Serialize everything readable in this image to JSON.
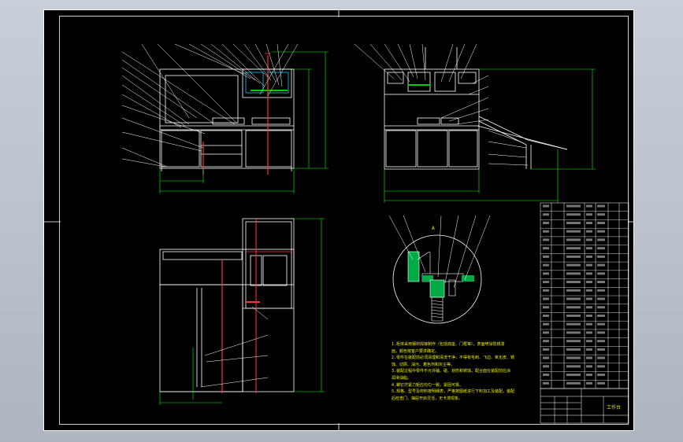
{
  "drawing": {
    "sheet_background": "#000000",
    "outer_frame_color": "#ffffff",
    "geometry_color": "#ffffff",
    "leader_color": "#ffffff",
    "dimension_color": "#00ff00",
    "section_line_color": "#ff3333",
    "hatch_color": "#00cc00",
    "text_color": "#f2f200",
    "cyan_color": "#00ccff"
  },
  "views": {
    "section_label": "A",
    "dim_labels": [
      "1800",
      "2200",
      "1790",
      "1600",
      "2460",
      "1200",
      "160",
      "1500",
      "600"
    ]
  },
  "notes": {
    "lines": [
      "1.柜体采用钢材焊接制作（包括底座、门框等），表面喷涂防锈漆",
      "面，颜色按客户要求确定。",
      "2.零件在装配前必须清理和清洗干净，不得有毛刺、飞边、氧化皮、锈",
      "蚀、切屑、油污、着色剂和灰尘等。",
      "3.装配过程中零件不允许磕、碰、划伤和锈蚀，配合面在装配前应涂",
      "润滑油脂。",
      "4.螺钉拧紧力矩应均匀一致，紧固可靠。",
      "5.规格、型号及材料按明细表，严格按图纸进行下料加工及装配，装配",
      "后检查门、抽屉开启灵活，无卡滞现象。"
    ]
  },
  "title_block": {
    "drawing_name": "工作台",
    "rows": 22
  }
}
